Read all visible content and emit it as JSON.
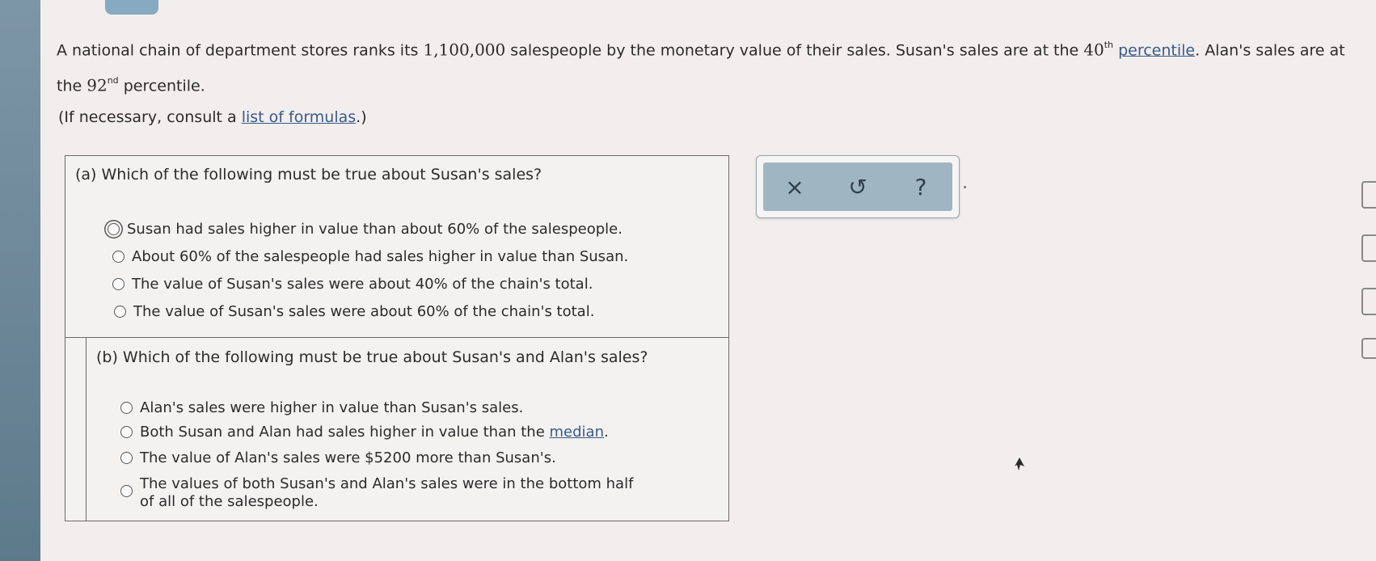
{
  "problem": {
    "text_1": "A national chain of department stores ranks its ",
    "count": "1,100,000",
    "text_2": " salespeople by the monetary value of their sales. Susan's sales are at the ",
    "susan_pct": "40",
    "susan_sup": "th",
    "percentile_link": "percentile",
    "text_3": ". Alan's sales are at the ",
    "alan_pct": "92",
    "alan_sup": "nd",
    "text_4": " percentile."
  },
  "consult": {
    "prefix": "(If necessary, consult a ",
    "link": "list of formulas",
    "suffix": ".)"
  },
  "part_a": {
    "title": "(a) Which of the following must be true about Susan's sales?",
    "options": [
      {
        "label": "Susan had sales higher in value than about 60% of the salespeople.",
        "selected": true
      },
      {
        "label": "About 60% of the salespeople had sales higher in value than Susan.",
        "selected": false
      },
      {
        "label": "The value of Susan's sales were about 40% of the chain's total.",
        "selected": false
      },
      {
        "label": "The value of Susan's sales were about 60% of the chain's total.",
        "selected": false
      }
    ]
  },
  "part_b": {
    "title": "(b) Which of the following must be true about Susan's and Alan's sales?",
    "options": [
      {
        "label": "Alan's sales were higher in value than Susan's sales.",
        "selected": false
      },
      {
        "label_prefix": "Both Susan and Alan had sales higher in value than the ",
        "link": "median",
        "label_suffix": ".",
        "selected": false
      },
      {
        "label": "The value of Alan's sales were $5200 more than Susan's.",
        "selected": false
      },
      {
        "label": "The values of both Susan's and Alan's sales were in the bottom half of all of the salespeople.",
        "selected": false
      }
    ]
  },
  "toolbar": {
    "clear": "×",
    "undo": "↺",
    "help": "?"
  },
  "icons": {
    "clear": "close-icon",
    "undo": "undo-icon",
    "help": "help-icon",
    "cursor": "mouse-cursor-icon"
  }
}
